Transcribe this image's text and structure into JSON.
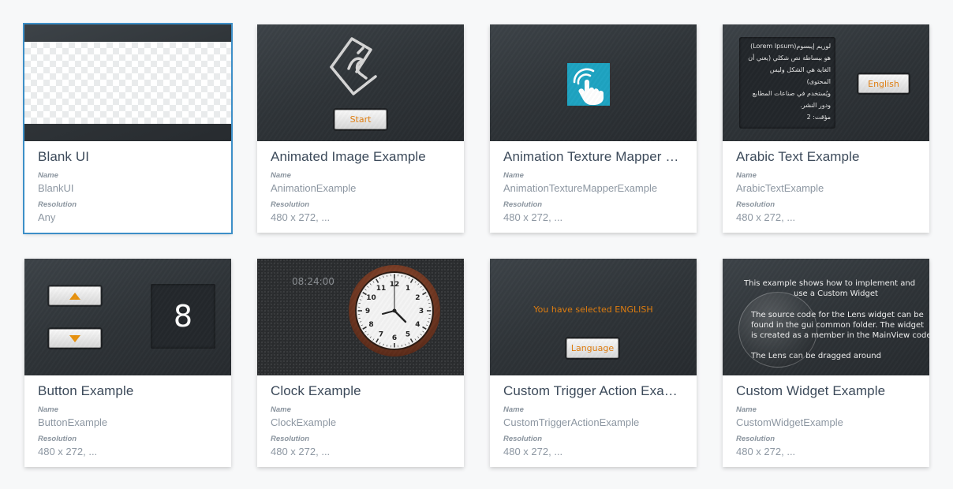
{
  "labels": {
    "name": "Name",
    "resolution": "Resolution"
  },
  "cards": [
    {
      "title": "Blank UI",
      "name": "BlankUI",
      "resolution": "Any",
      "thumb": "checkerboard"
    },
    {
      "title": "Animated Image Example",
      "name": "AnimationExample",
      "resolution": "480 x 272, ...",
      "thumb": "animated-logo",
      "button": "Start"
    },
    {
      "title": "Animation Texture Mapper Example",
      "name": "AnimationTextureMapperExample",
      "resolution": "480 x 272, ...",
      "thumb": "touch-icon"
    },
    {
      "title": "Arabic Text Example",
      "name": "ArabicTextExample",
      "resolution": "480 x 272, ...",
      "thumb": "arabic-text",
      "button": "English",
      "arabic_lines": [
        "لوريم إيبسوم(Lorem Ipsum)",
        "هو ببساطة نص شكلي (يعني أن",
        "الغاية هي الشكل وليس المحتوى)",
        "ويُستخدم في صناعات المطابع",
        "ودور النشر.",
        "مؤقت: 2"
      ]
    },
    {
      "title": "Button Example",
      "name": "ButtonExample",
      "resolution": "480 x 272, ...",
      "thumb": "up-down-buttons",
      "counter": "8"
    },
    {
      "title": "Clock Example",
      "name": "ClockExample",
      "resolution": "480 x 272, ...",
      "thumb": "analog-clock",
      "time": "08:24:00",
      "clock_numbers": [
        "12",
        "1",
        "2",
        "3",
        "4",
        "5",
        "6",
        "7",
        "8",
        "9",
        "10",
        "11"
      ]
    },
    {
      "title": "Custom Trigger Action Example",
      "name": "CustomTriggerActionExample",
      "resolution": "480 x 272, ...",
      "thumb": "language-select",
      "message": "You have selected ENGLISH",
      "button": "Language"
    },
    {
      "title": "Custom Widget Example",
      "name": "CustomWidgetExample",
      "resolution": "480 x 272, ...",
      "thumb": "lens-widget",
      "lens_lines": [
        "This example shows how to implement and",
        "use a Custom Widget",
        "The source code for the Lens widget  can be",
        "found in the gui common folder. The widget",
        "is created as a member in the MainView code",
        "The Lens can be dragged around"
      ]
    }
  ],
  "colors": {
    "selected_outline": "#3d8fc8",
    "accent_orange": "#e07d0e",
    "title_text": "#3c4a5a",
    "thumb_dark": "#2f3438",
    "icon_teal": "#1ea4c2"
  }
}
